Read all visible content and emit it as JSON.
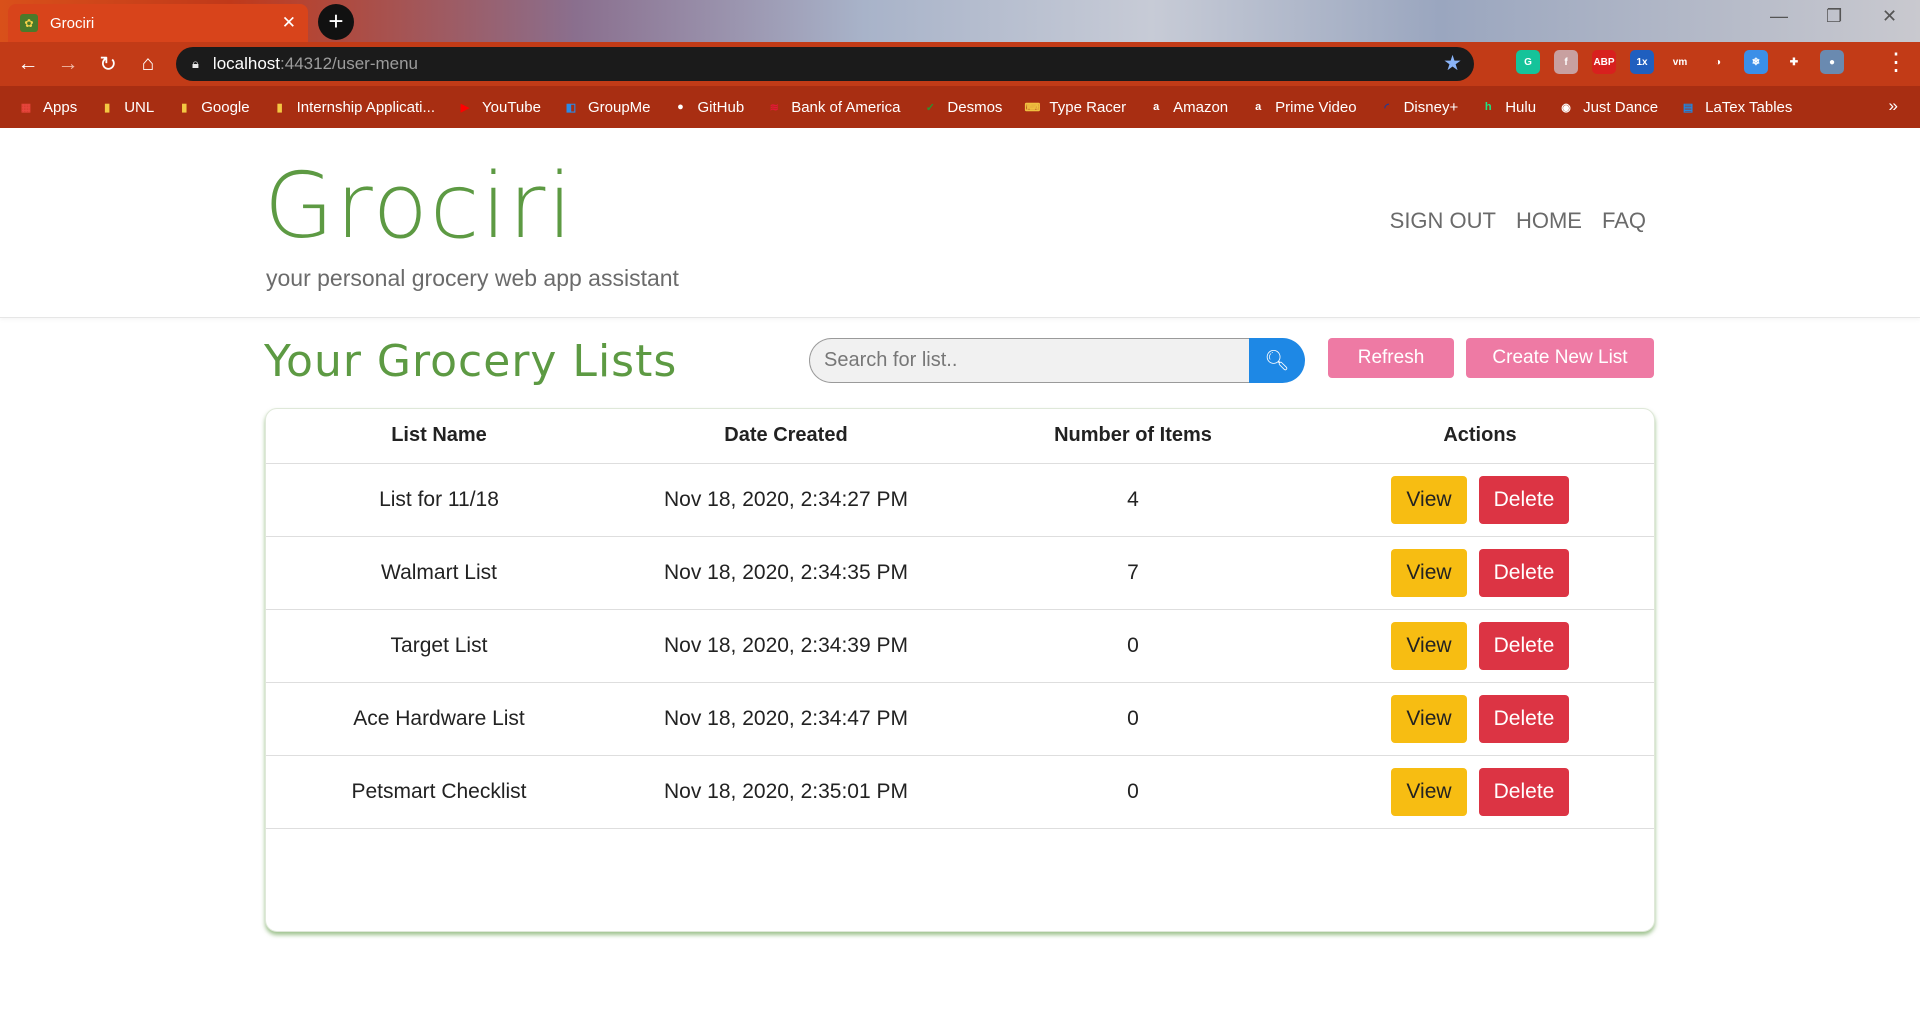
{
  "browser": {
    "tab_title": "Grociri",
    "url_host": "localhost",
    "url_rest": ":44312/user-menu",
    "bookmarks": [
      {
        "label": "Apps",
        "icon": "apps-grid-icon",
        "color": "#e8453c"
      },
      {
        "label": "UNL",
        "icon": "folder-icon",
        "color": "#f4c842"
      },
      {
        "label": "Google",
        "icon": "folder-icon",
        "color": "#f4c842"
      },
      {
        "label": "Internship Applicati...",
        "icon": "folder-icon",
        "color": "#f4c842"
      },
      {
        "label": "YouTube",
        "icon": "youtube-icon",
        "color": "#ff0000"
      },
      {
        "label": "GroupMe",
        "icon": "groupme-icon",
        "color": "#2b8ae6"
      },
      {
        "label": "GitHub",
        "icon": "github-icon",
        "color": "#ffffff"
      },
      {
        "label": "Bank of America",
        "icon": "bofa-icon",
        "color": "#e31837"
      },
      {
        "label": "Desmos",
        "icon": "desmos-icon",
        "color": "#2f8f2f"
      },
      {
        "label": "Type Racer",
        "icon": "typeracer-icon",
        "color": "#f0c040"
      },
      {
        "label": "Amazon",
        "icon": "amazon-icon",
        "color": "#ffffff"
      },
      {
        "label": "Prime Video",
        "icon": "amazon-icon",
        "color": "#ffffff"
      },
      {
        "label": "Disney+",
        "icon": "disney-icon",
        "color": "#1a3c9e"
      },
      {
        "label": "Hulu",
        "icon": "hulu-icon",
        "color": "#1ce783"
      },
      {
        "label": "Just Dance",
        "icon": "justdance-icon",
        "color": "#ffffff"
      },
      {
        "label": "LaTex Tables",
        "icon": "latex-icon",
        "color": "#1e88e5"
      }
    ],
    "bookmarks_more": "»",
    "extensions": [
      {
        "name": "grammarly-icon",
        "text": "G",
        "color": "#15c39a"
      },
      {
        "name": "extension-icon",
        "text": "f",
        "color": "#c8a0a0"
      },
      {
        "name": "adblock-plus-icon",
        "text": "ABP",
        "color": "#d8201e"
      },
      {
        "name": "video-speed-icon",
        "text": "1x",
        "color": "#1f5fbf"
      },
      {
        "name": "vm-icon",
        "text": "vm",
        "color": "#ffffff"
      },
      {
        "name": "speedometer-icon",
        "text": "◑",
        "color": "#ffffff"
      },
      {
        "name": "snowflake-icon",
        "text": "❄",
        "color": "#3b8fe8"
      },
      {
        "name": "puzzle-icon",
        "text": "✚",
        "color": "#ffffff"
      },
      {
        "name": "profile-avatar-icon",
        "text": "●",
        "color": "#6a8ab0"
      }
    ]
  },
  "site": {
    "brand": "Grociri",
    "tagline": "your personal grocery web app assistant",
    "nav": [
      "SIGN OUT",
      "HOME",
      "FAQ"
    ]
  },
  "lists_section": {
    "title": "Your Grocery Lists",
    "search_placeholder": "Search for list..",
    "refresh_label": "Refresh",
    "create_label": "Create New List"
  },
  "table": {
    "headers": [
      "List Name",
      "Date Created",
      "Number of Items",
      "Actions"
    ],
    "view_label": "View",
    "delete_label": "Delete",
    "rows": [
      {
        "name": "List for 11/18",
        "date": "Nov 18, 2020, 2:34:27 PM",
        "items": "4"
      },
      {
        "name": "Walmart List",
        "date": "Nov 18, 2020, 2:34:35 PM",
        "items": "7"
      },
      {
        "name": "Target List",
        "date": "Nov 18, 2020, 2:34:39 PM",
        "items": "0"
      },
      {
        "name": "Ace Hardware List",
        "date": "Nov 18, 2020, 2:34:47 PM",
        "items": "0"
      },
      {
        "name": "Petsmart Checklist",
        "date": "Nov 18, 2020, 2:35:01 PM",
        "items": "0"
      }
    ]
  },
  "colors": {
    "brand_green": "#5d9a43",
    "pink": "#ee7aa4",
    "view_yellow": "#f7bd12",
    "delete_red": "#dc3444",
    "search_blue": "#1e88e5"
  }
}
